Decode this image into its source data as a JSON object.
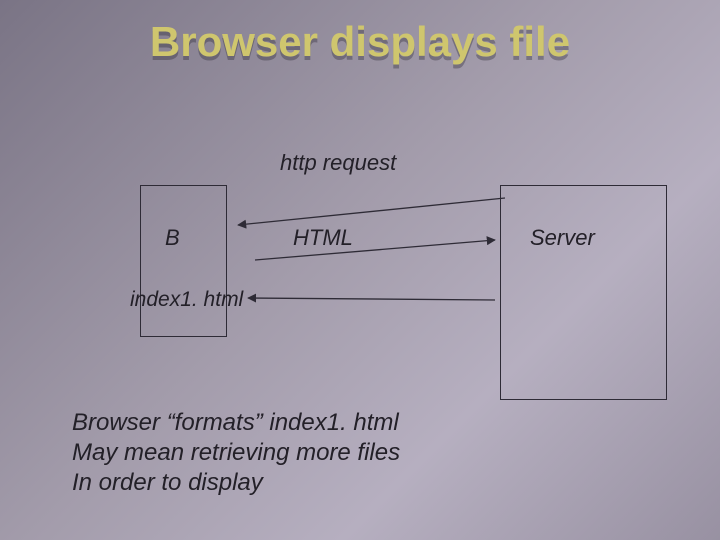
{
  "title": "Browser displays file",
  "labels": {
    "http": "http request",
    "b": "B",
    "html": "HTML",
    "server": "Server",
    "index": "index1. html"
  },
  "caption": {
    "line1": "Browser  “formats” index1. html",
    "line2": "May mean retrieving more files",
    "line3": "In order to display"
  }
}
